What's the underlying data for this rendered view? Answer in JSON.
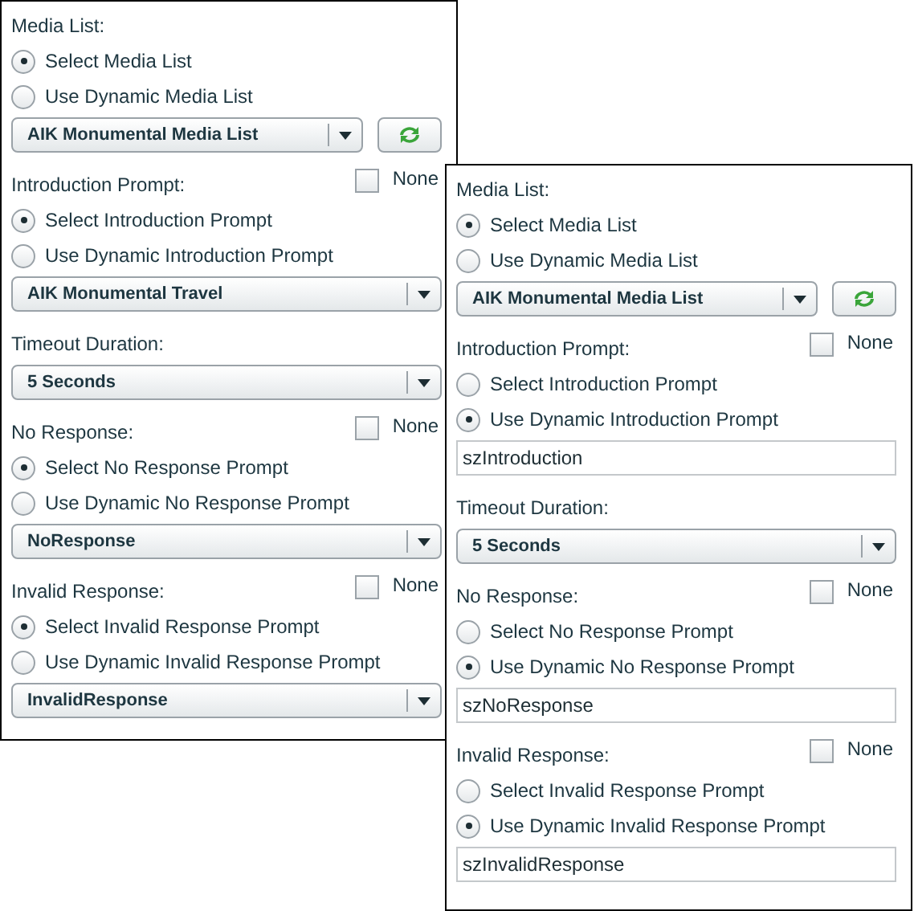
{
  "panels": [
    {
      "sections": [
        {
          "label": "Media List:",
          "options": [
            {
              "label": "Select Media List",
              "selected": true
            },
            {
              "label": "Use Dynamic Media List",
              "selected": false
            }
          ],
          "control": {
            "kind": "dropdown",
            "value": "AIK Monumental Media List"
          },
          "refresh": true
        },
        {
          "label": "Introduction Prompt:",
          "none": {
            "label": "None",
            "checked": false
          },
          "options": [
            {
              "label": "Select Introduction Prompt",
              "selected": true
            },
            {
              "label": "Use Dynamic Introduction Prompt",
              "selected": false
            }
          ],
          "control": {
            "kind": "dropdown",
            "value": "AIK Monumental Travel"
          }
        },
        {
          "label": "Timeout Duration:",
          "control": {
            "kind": "dropdown",
            "value": "5 Seconds"
          }
        },
        {
          "label": "No Response:",
          "none": {
            "label": "None",
            "checked": false
          },
          "options": [
            {
              "label": "Select No Response Prompt",
              "selected": true
            },
            {
              "label": "Use Dynamic No Response Prompt",
              "selected": false
            }
          ],
          "control": {
            "kind": "dropdown",
            "value": "NoResponse"
          }
        },
        {
          "label": "Invalid Response:",
          "none": {
            "label": "None",
            "checked": false
          },
          "options": [
            {
              "label": "Select Invalid Response Prompt",
              "selected": true
            },
            {
              "label": "Use Dynamic Invalid Response Prompt",
              "selected": false
            }
          ],
          "control": {
            "kind": "dropdown",
            "value": "InvalidResponse"
          }
        }
      ]
    },
    {
      "sections": [
        {
          "label": "Media List:",
          "options": [
            {
              "label": "Select Media List",
              "selected": true
            },
            {
              "label": "Use Dynamic Media List",
              "selected": false
            }
          ],
          "control": {
            "kind": "dropdown",
            "value": "AIK Monumental Media List"
          },
          "refresh": true
        },
        {
          "label": "Introduction Prompt:",
          "none": {
            "label": "None",
            "checked": false
          },
          "options": [
            {
              "label": "Select Introduction Prompt",
              "selected": false
            },
            {
              "label": "Use Dynamic Introduction Prompt",
              "selected": true
            }
          ],
          "control": {
            "kind": "text",
            "value": "szIntroduction"
          }
        },
        {
          "label": "Timeout Duration:",
          "control": {
            "kind": "dropdown",
            "value": "5 Seconds"
          }
        },
        {
          "label": "No Response:",
          "none": {
            "label": "None",
            "checked": false
          },
          "options": [
            {
              "label": "Select No Response Prompt",
              "selected": false
            },
            {
              "label": "Use Dynamic No Response Prompt",
              "selected": true
            }
          ],
          "control": {
            "kind": "text",
            "value": "szNoResponse"
          }
        },
        {
          "label": "Invalid Response:",
          "none": {
            "label": "None",
            "checked": false
          },
          "options": [
            {
              "label": "Select Invalid Response Prompt",
              "selected": false
            },
            {
              "label": "Use Dynamic Invalid Response Prompt",
              "selected": true
            }
          ],
          "control": {
            "kind": "text",
            "value": "szInvalidResponse"
          }
        }
      ]
    }
  ]
}
